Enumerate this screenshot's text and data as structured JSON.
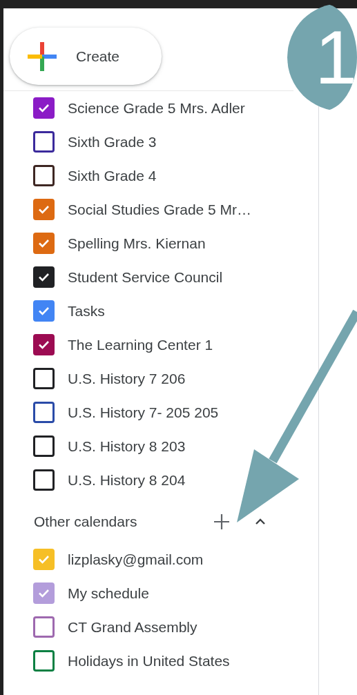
{
  "create_button": {
    "label": "Create"
  },
  "step_badge": {
    "label": "1"
  },
  "my_calendars": [
    {
      "label": "Science Grade 5 Mrs. Adler",
      "checked": true,
      "color": "#8b1cc6"
    },
    {
      "label": "Sixth Grade 3",
      "checked": false,
      "color": "#3b2a9c"
    },
    {
      "label": "Sixth Grade 4",
      "checked": false,
      "color": "#3e2723"
    },
    {
      "label": "Social Studies Grade 5 Mr…",
      "checked": true,
      "color": "#dd6a12"
    },
    {
      "label": "Spelling Mrs. Kiernan",
      "checked": true,
      "color": "#dd6a12"
    },
    {
      "label": "Student Service Council",
      "checked": true,
      "color": "#202124"
    },
    {
      "label": "Tasks",
      "checked": true,
      "color": "#4285f4"
    },
    {
      "label": "The Learning Center 1",
      "checked": true,
      "color": "#9c0b52"
    },
    {
      "label": "U.S. History 7 206",
      "checked": false,
      "color": "#202124"
    },
    {
      "label": "U.S. History 7- 205 205",
      "checked": false,
      "color": "#2a4ba8"
    },
    {
      "label": "U.S. History 8 203",
      "checked": false,
      "color": "#202124"
    },
    {
      "label": "U.S. History 8 204",
      "checked": false,
      "color": "#202124"
    }
  ],
  "other_calendars": {
    "title": "Other calendars",
    "expanded": true,
    "items": [
      {
        "label": "lizplasky@gmail.com",
        "checked": true,
        "color": "#f6bf26"
      },
      {
        "label": "My schedule",
        "checked": true,
        "color": "#b39ddb"
      },
      {
        "label": "CT Grand Assembly",
        "checked": false,
        "color": "#9e69af"
      },
      {
        "label": "Holidays in United States",
        "checked": false,
        "color": "#0b8043"
      }
    ]
  }
}
